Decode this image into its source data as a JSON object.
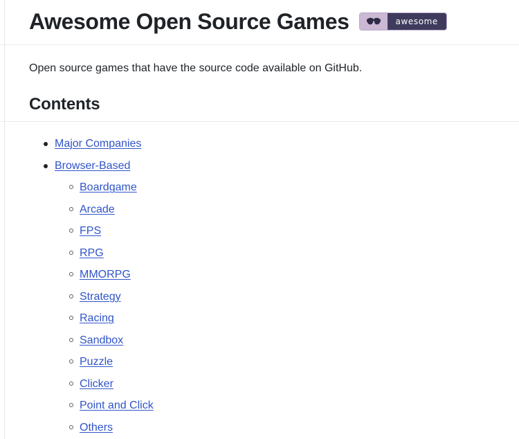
{
  "header": {
    "title": "Awesome Open Source Games",
    "badge": {
      "icon": "sunglasses-icon",
      "label": "awesome",
      "left_bg": "#cbb8d4",
      "right_bg": "#3f3b5c",
      "text_color": "#ffffff"
    }
  },
  "intro": {
    "text": "Open source games that have the source code available on GitHub."
  },
  "contents": {
    "heading": "Contents",
    "items": [
      {
        "label": "Major Companies",
        "level": 1
      },
      {
        "label": "Browser-Based",
        "level": 1
      },
      {
        "label": "Boardgame",
        "level": 2
      },
      {
        "label": "Arcade",
        "level": 2
      },
      {
        "label": "FPS",
        "level": 2
      },
      {
        "label": "RPG",
        "level": 2
      },
      {
        "label": "MMORPG",
        "level": 2
      },
      {
        "label": "Strategy",
        "level": 2
      },
      {
        "label": "Racing",
        "level": 2
      },
      {
        "label": "Sandbox",
        "level": 2
      },
      {
        "label": "Puzzle",
        "level": 2
      },
      {
        "label": "Clicker",
        "level": 2
      },
      {
        "label": "Point and Click",
        "level": 2
      },
      {
        "label": "Others",
        "level": 2
      }
    ]
  },
  "theme": {
    "link_color": "#2f54c8",
    "text_color": "#1f2328",
    "rule_color": "#eaecef",
    "background": "#ffffff"
  }
}
